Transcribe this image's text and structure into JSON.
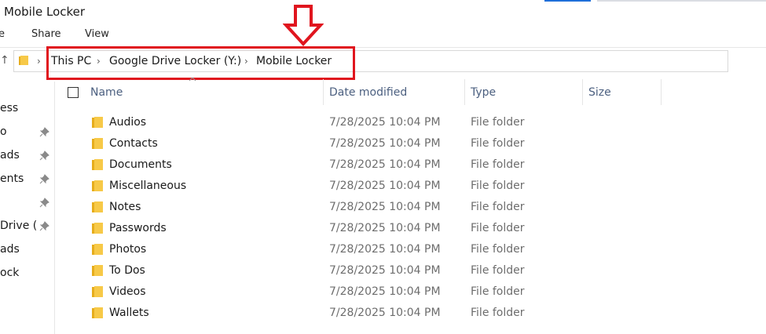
{
  "window": {
    "title": "Mobile Locker"
  },
  "ribbon": {
    "tabs": [
      {
        "label": "e"
      },
      {
        "label": "Share"
      },
      {
        "label": "View"
      }
    ]
  },
  "address_bar": {
    "crumbs": [
      {
        "label": "This PC"
      },
      {
        "label": "Google Drive Locker (Y:)"
      },
      {
        "label": "Mobile Locker"
      }
    ]
  },
  "annotation": {
    "highlight_color": "#e0151e"
  },
  "nav_pane": {
    "items": [
      {
        "label": "ess",
        "pinned": false
      },
      {
        "label": "o",
        "pinned": true
      },
      {
        "label": "ads",
        "pinned": true
      },
      {
        "label": "ents",
        "pinned": true
      },
      {
        "label": "",
        "pinned": true
      },
      {
        "label": "Drive (",
        "pinned": true
      },
      {
        "label": "ads",
        "pinned": false
      },
      {
        "label": "ock",
        "pinned": false
      }
    ]
  },
  "columns": {
    "name": "Name",
    "date_modified": "Date modified",
    "type": "Type",
    "size": "Size"
  },
  "files": [
    {
      "name": "Audios",
      "date": "7/28/2025 10:04 PM",
      "type": "File folder"
    },
    {
      "name": "Contacts",
      "date": "7/28/2025 10:04 PM",
      "type": "File folder"
    },
    {
      "name": "Documents",
      "date": "7/28/2025 10:04 PM",
      "type": "File folder"
    },
    {
      "name": "Miscellaneous",
      "date": "7/28/2025 10:04 PM",
      "type": "File folder"
    },
    {
      "name": "Notes",
      "date": "7/28/2025 10:04 PM",
      "type": "File folder"
    },
    {
      "name": "Passwords",
      "date": "7/28/2025 10:04 PM",
      "type": "File folder"
    },
    {
      "name": "Photos",
      "date": "7/28/2025 10:04 PM",
      "type": "File folder"
    },
    {
      "name": "To Dos",
      "date": "7/28/2025 10:04 PM",
      "type": "File folder"
    },
    {
      "name": "Videos",
      "date": "7/28/2025 10:04 PM",
      "type": "File folder"
    },
    {
      "name": "Wallets",
      "date": "7/28/2025 10:04 PM",
      "type": "File folder"
    }
  ],
  "colors": {
    "folder": "#f7c948",
    "folder_dark": "#e6ad1c",
    "accent": "#1e6fd9"
  }
}
